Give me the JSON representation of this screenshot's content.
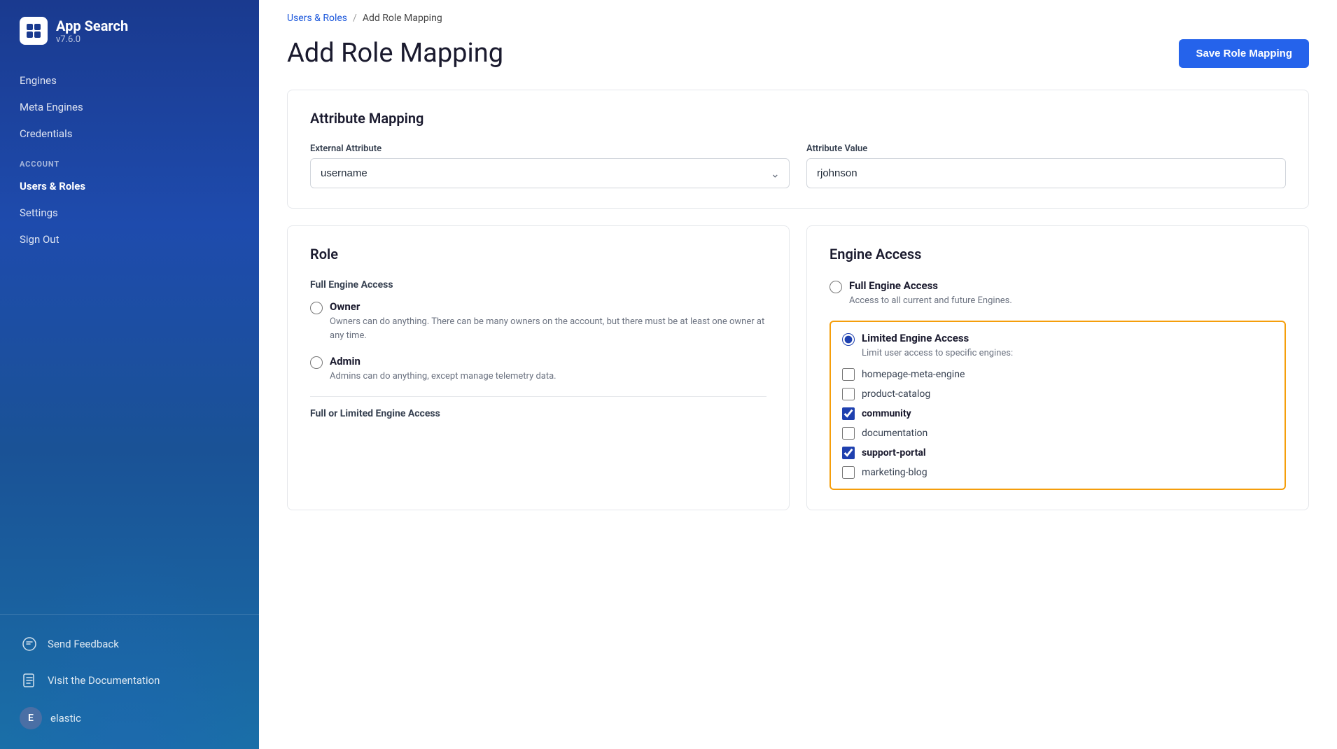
{
  "sidebar": {
    "app_name": "App Search",
    "app_version": "v7.6.0",
    "logo_icon": "🔷",
    "nav_items": [
      {
        "label": "Engines",
        "active": false
      },
      {
        "label": "Meta Engines",
        "active": false
      },
      {
        "label": "Credentials",
        "active": false
      }
    ],
    "account_section_label": "ACCOUNT",
    "account_items": [
      {
        "label": "Users & Roles",
        "active": true
      },
      {
        "label": "Settings",
        "active": false
      },
      {
        "label": "Sign Out",
        "active": false
      }
    ],
    "footer_items": [
      {
        "label": "Send Feedback",
        "icon": "💬"
      },
      {
        "label": "Visit the Documentation",
        "icon": "📋"
      }
    ],
    "user": {
      "avatar_letter": "E",
      "username": "elastic"
    }
  },
  "breadcrumb": {
    "parent_label": "Users & Roles",
    "separator": "/",
    "current_label": "Add Role Mapping"
  },
  "page": {
    "title": "Add Role Mapping",
    "save_button_label": "Save Role Mapping"
  },
  "attribute_mapping": {
    "section_title": "Attribute Mapping",
    "external_attribute_label": "External Attribute",
    "external_attribute_value": "username",
    "attribute_value_label": "Attribute Value",
    "attribute_value_input": "rjohnson"
  },
  "role_panel": {
    "section_title": "Role",
    "full_engine_access_heading": "Full Engine Access",
    "options": [
      {
        "id": "owner",
        "label": "Owner",
        "description": "Owners can do anything. There can be many owners on the account, but there must be at least one owner at any time.",
        "checked": false
      },
      {
        "id": "admin",
        "label": "Admin",
        "description": "Admins can do anything, except manage telemetry data.",
        "checked": false
      }
    ],
    "full_or_limited_heading": "Full or Limited Engine Access"
  },
  "engine_access_panel": {
    "section_title": "Engine Access",
    "full_engine_access": {
      "label": "Full Engine Access",
      "description": "Access to all current and future Engines.",
      "checked": false
    },
    "limited_engine_access": {
      "label": "Limited Engine Access",
      "description": "Limit user access to specific engines:",
      "checked": true,
      "engines": [
        {
          "name": "homepage-meta-engine",
          "checked": false
        },
        {
          "name": "product-catalog",
          "checked": false
        },
        {
          "name": "community",
          "checked": true
        },
        {
          "name": "documentation",
          "checked": false
        },
        {
          "name": "support-portal",
          "checked": true
        },
        {
          "name": "marketing-blog",
          "checked": false
        }
      ]
    }
  }
}
